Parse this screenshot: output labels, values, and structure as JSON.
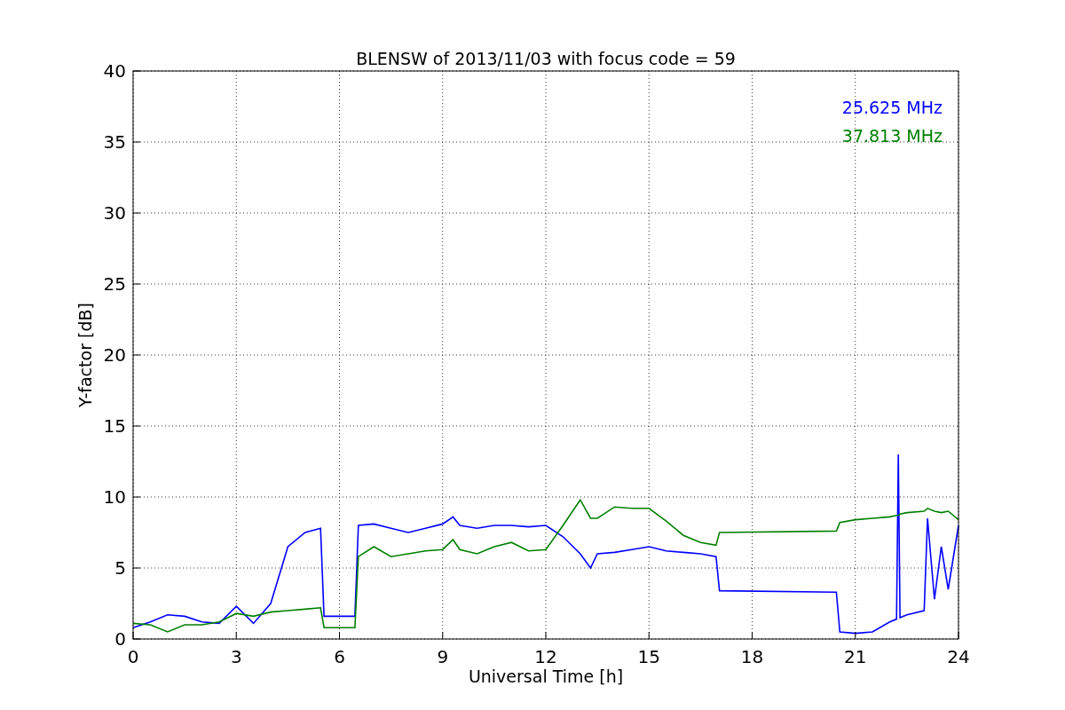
{
  "chart_data": {
    "type": "line",
    "title": "BLENSW of 2013/11/03 with focus code = 59",
    "xlabel": "Universal Time [h]",
    "ylabel": "Y-factor [dB]",
    "x": [
      0,
      0.5,
      1,
      1.5,
      2,
      2.5,
      3,
      3.5,
      4,
      4.5,
      5,
      5.45,
      5.55,
      6,
      6.45,
      6.55,
      7,
      7.5,
      8,
      8.5,
      9,
      9.3,
      9.5,
      10,
      10.5,
      11,
      11.5,
      12,
      12.5,
      13,
      13.3,
      13.5,
      14,
      14.5,
      15,
      15.5,
      16,
      16.5,
      16.95,
      17.05,
      20.45,
      20.55,
      21,
      21.5,
      22,
      22.2,
      22.25,
      22.3,
      22.5,
      23,
      23.1,
      23.3,
      23.5,
      23.7,
      24
    ],
    "series": [
      {
        "name": "25.625 MHz",
        "color": "#0000ff",
        "values": [
          0.8,
          1.2,
          1.7,
          1.6,
          1.2,
          1.1,
          2.3,
          1.1,
          2.5,
          6.5,
          7.5,
          7.8,
          1.6,
          1.6,
          1.6,
          8.0,
          8.1,
          7.8,
          7.5,
          7.8,
          8.1,
          8.6,
          8.0,
          7.8,
          8.0,
          8.0,
          7.9,
          8.0,
          7.2,
          6.0,
          5.0,
          6.0,
          6.1,
          6.3,
          6.5,
          6.2,
          6.1,
          6.0,
          5.8,
          3.4,
          3.3,
          0.5,
          0.4,
          0.5,
          1.2,
          1.4,
          13.0,
          1.5,
          1.7,
          2.0,
          8.5,
          2.8,
          6.5,
          3.5,
          8.0
        ]
      },
      {
        "name": "37.813 MHz",
        "color": "#008000",
        "values": [
          1.1,
          1.0,
          0.5,
          1.0,
          1.0,
          1.2,
          1.8,
          1.6,
          1.9,
          2.0,
          2.1,
          2.2,
          0.8,
          0.8,
          0.8,
          5.8,
          6.5,
          5.8,
          6.0,
          6.2,
          6.3,
          7.0,
          6.3,
          6.0,
          6.5,
          6.8,
          6.2,
          6.3,
          8.0,
          9.8,
          8.5,
          8.5,
          9.3,
          9.2,
          9.2,
          8.3,
          7.3,
          6.8,
          6.6,
          7.5,
          7.6,
          8.2,
          8.4,
          8.5,
          8.6,
          8.7,
          8.7,
          8.8,
          8.9,
          9.0,
          9.2,
          9.0,
          8.9,
          9.0,
          8.4
        ]
      }
    ],
    "grid": true,
    "xlim": [
      0,
      24
    ],
    "ylim": [
      0,
      40
    ],
    "xticks": [
      0,
      3,
      6,
      9,
      12,
      15,
      18,
      21,
      24
    ],
    "yticks": [
      0,
      5,
      10,
      15,
      20,
      25,
      30,
      35,
      40
    ]
  }
}
